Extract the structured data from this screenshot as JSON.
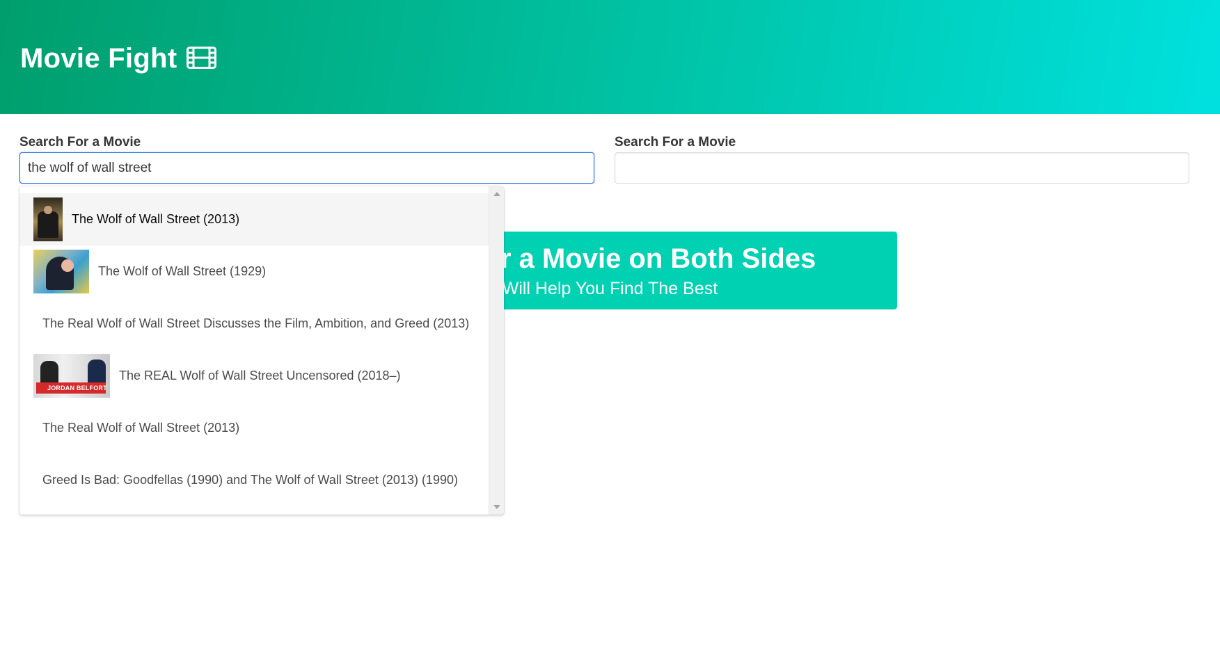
{
  "header": {
    "title": "Movie Fight",
    "icon": "film-icon"
  },
  "left_search": {
    "label": "Search For a Movie",
    "value": "the wolf of wall street",
    "placeholder": ""
  },
  "right_search": {
    "label": "Search For a Movie",
    "value": "",
    "placeholder": ""
  },
  "tutorial": {
    "title": "Search for a Movie on Both Sides",
    "subtitle": "We Will Help You Find The Best"
  },
  "dropdown": {
    "items": [
      {
        "label": "The Wolf of Wall Street (2013)",
        "thumb": "poster-wolf-2013",
        "active": true
      },
      {
        "label": "The Wolf of Wall Street (1929)",
        "thumb": "poster-wolf-1929",
        "active": false
      },
      {
        "label": "The Real Wolf of Wall Street Discusses the Film, Ambition, and Greed (2013)",
        "thumb": "",
        "active": false
      },
      {
        "label": "The REAL Wolf of Wall Street Uncensored (2018–)",
        "thumb": "poster-jordan-belfort",
        "active": false
      },
      {
        "label": "The Real Wolf of Wall Street (2013)",
        "thumb": "",
        "active": false
      },
      {
        "label": "Greed Is Bad: Goodfellas (1990) and The Wolf of Wall Street (2013) (1990)",
        "thumb": "",
        "active": false
      }
    ],
    "thumb_caption": "JORDAN BELFORT"
  },
  "colors": {
    "hero_start": "#009e6c",
    "hero_end": "#00e1df",
    "tutorial_bg": "#00d1b2",
    "focus_border": "#3273dc"
  }
}
